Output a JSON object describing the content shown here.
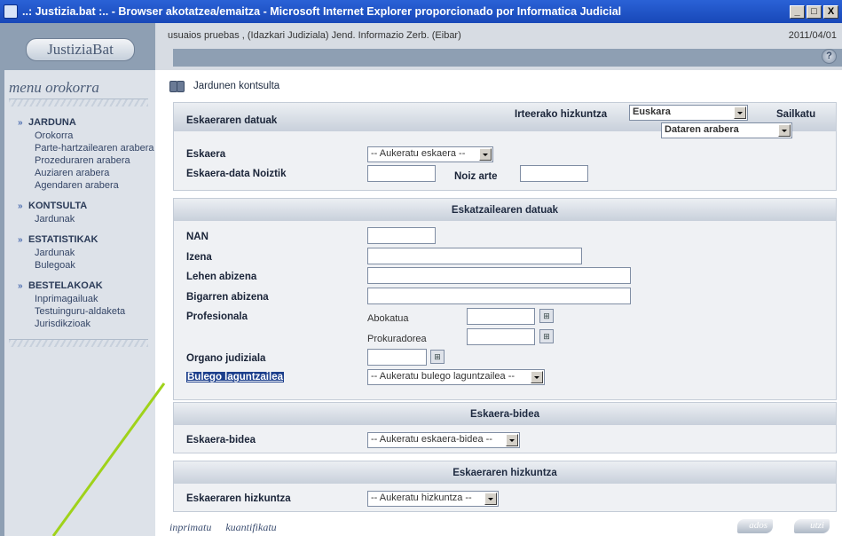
{
  "window": {
    "title": "..: Justizia.bat :.. - Browser akotatzea/emaitza - Microsoft Internet Explorer proporcionado por Informatica Judicial",
    "min_label": "_",
    "max_label": "□",
    "close_label": "X"
  },
  "logo": {
    "text": "JustiziaBat"
  },
  "header": {
    "user_line": "usuaios pruebas , (Idazkari Judiziala)  Jend. Informazio Zerb. (Eibar)",
    "date": "2011/04/01",
    "help_label": "?"
  },
  "sidebar": {
    "title": "menu orokorra",
    "sections": [
      {
        "head": "JARDUNA",
        "items": [
          "Orokorra",
          "Parte-hartzailearen arabera",
          "Prozeduraren arabera",
          "Auziaren arabera",
          "Agendaren arabera"
        ]
      },
      {
        "head": "KONTSULTA",
        "items": [
          "Jardunak"
        ]
      },
      {
        "head": "ESTATISTIKAK",
        "items": [
          "Jardunak",
          "Bulegoak"
        ]
      },
      {
        "head": "BESTELAKOAK",
        "items": [
          "Inprimagailuak",
          "Testuinguru-aldaketa",
          "Jurisdikzioak"
        ]
      }
    ]
  },
  "page": {
    "title": "Jardunen kontsulta"
  },
  "panel1": {
    "heading": "Eskaeraren datuak",
    "output_lang_label": "Irteerako hizkuntza",
    "output_lang_value": "Euskara",
    "sort_label": "Sailkatu",
    "sort_value": "Dataren arabera",
    "eskaera_label": "Eskaera",
    "eskaera_value": "-- Aukeratu eskaera --",
    "date_from_label": "Eskaera-data Noiztik",
    "date_to_label": "Noiz arte"
  },
  "panel2": {
    "heading": "Eskatzailearen datuak",
    "nan_label": "NAN",
    "izena_label": "Izena",
    "lehen_label": "Lehen abizena",
    "bigarren_label": "Bigarren abizena",
    "profesionala_label": "Profesionala",
    "abokatua_label": "Abokatua",
    "prokuradorea_label": "Prokuradorea",
    "organo_label": "Organo judiziala",
    "bulego_label": "Bulego laguntzailea",
    "bulego_value": "-- Aukeratu bulego laguntzailea --"
  },
  "panel3": {
    "heading": "Eskaera-bidea",
    "label": "Eskaera-bidea",
    "value": "-- Aukeratu eskaera-bidea --"
  },
  "panel4": {
    "heading": "Eskaeraren hizkuntza",
    "label": "Eskaeraren hizkuntza",
    "value": "-- Aukeratu hizkuntza --"
  },
  "footer": {
    "print_link": "inprimatu",
    "quantify_link": "kuantifikatu",
    "ok_button": "ados",
    "exit_button": "utzi"
  },
  "colors": {
    "titlebar": "#1848b8",
    "sidebar": "#8e9fb3",
    "panel_bg": "#eff1f4",
    "annotation_line": "#9fd21a"
  },
  "icons": {
    "binoculars": "binoculars-icon",
    "help": "help-icon",
    "menu_arrow": "double-arrow-icon"
  }
}
